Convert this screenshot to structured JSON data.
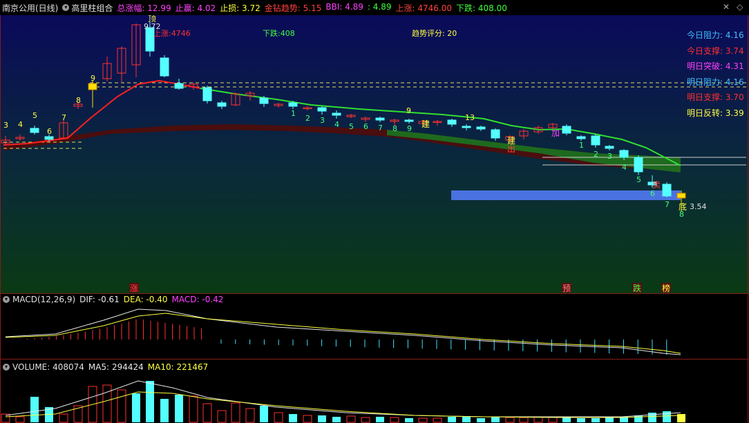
{
  "header": {
    "stock": "南京公用(日线)",
    "indicator": "高里柱组合",
    "items": [
      {
        "label": "总涨幅:",
        "value": "12.99",
        "color": "#ff40ff"
      },
      {
        "label": "止赢:",
        "value": "4.02",
        "color": "#ff40ff"
      },
      {
        "label": "止损:",
        "value": "3.72",
        "color": "#ffff40"
      },
      {
        "label": "金钻趋势:",
        "value": "5.15",
        "color": "#ff4040"
      },
      {
        "label": "BBI:",
        "value": "4.89",
        "color": "#ff40ff"
      },
      {
        "label": ":",
        "value": "4.89",
        "color": "#40ff40"
      },
      {
        "label": "上涨:",
        "value": "4746.00",
        "color": "#ff4040"
      },
      {
        "label": "下跌:",
        "value": "408.00",
        "color": "#40ff40"
      }
    ]
  },
  "main_chart": {
    "up_label": "上涨:4746",
    "down_label": "下跌:408",
    "trend_score": "趋势评分:  20",
    "peak_label": "9.72",
    "low_label": "3.54",
    "right_labels": [
      {
        "text": "今日阻力: 4.16",
        "color": "#40c0ff"
      },
      {
        "text": "今日支撑: 3.74",
        "color": "#ff3030"
      },
      {
        "text": "明日突破: 4.31",
        "color": "#ff40ff"
      },
      {
        "text": "明日阻力: 4.16",
        "color": "#40c0ff"
      },
      {
        "text": "明日支撑: 3.70",
        "color": "#ff3030"
      },
      {
        "text": "明日反转: 3.39",
        "color": "#ffff40"
      }
    ],
    "bottom_markers": [
      "涨",
      "预",
      "跌",
      "榜"
    ],
    "signal_chars": {
      "zheng": "顶",
      "jian": "建",
      "jia": "加",
      "di": "底",
      "chu": "出",
      "mai": "卖"
    },
    "counts_up": [
      "3",
      "4",
      "5",
      "6",
      "7",
      "8",
      "9"
    ],
    "counts_down": [
      "1",
      "2",
      "3",
      "4",
      "5",
      "6",
      "7",
      "8",
      "9"
    ],
    "counts_down2": [
      "1",
      "2",
      "3",
      "4",
      "5",
      "6",
      "7",
      "8"
    ],
    "count_13": "13"
  },
  "macd": {
    "title": "MACD(12,26,9)",
    "dif": "DIF: -0.61",
    "dea": "DEA: -0.40",
    "macd": "MACD: -0.42"
  },
  "volume": {
    "title": "VOLUME: 408074",
    "ma5": "MA5: 294424",
    "ma10": "MA10: 221467"
  },
  "colors": {
    "up": "#ff3030",
    "down": "#54ffff",
    "ma_red": "#ff2020",
    "ma_green": "#30e030"
  }
}
